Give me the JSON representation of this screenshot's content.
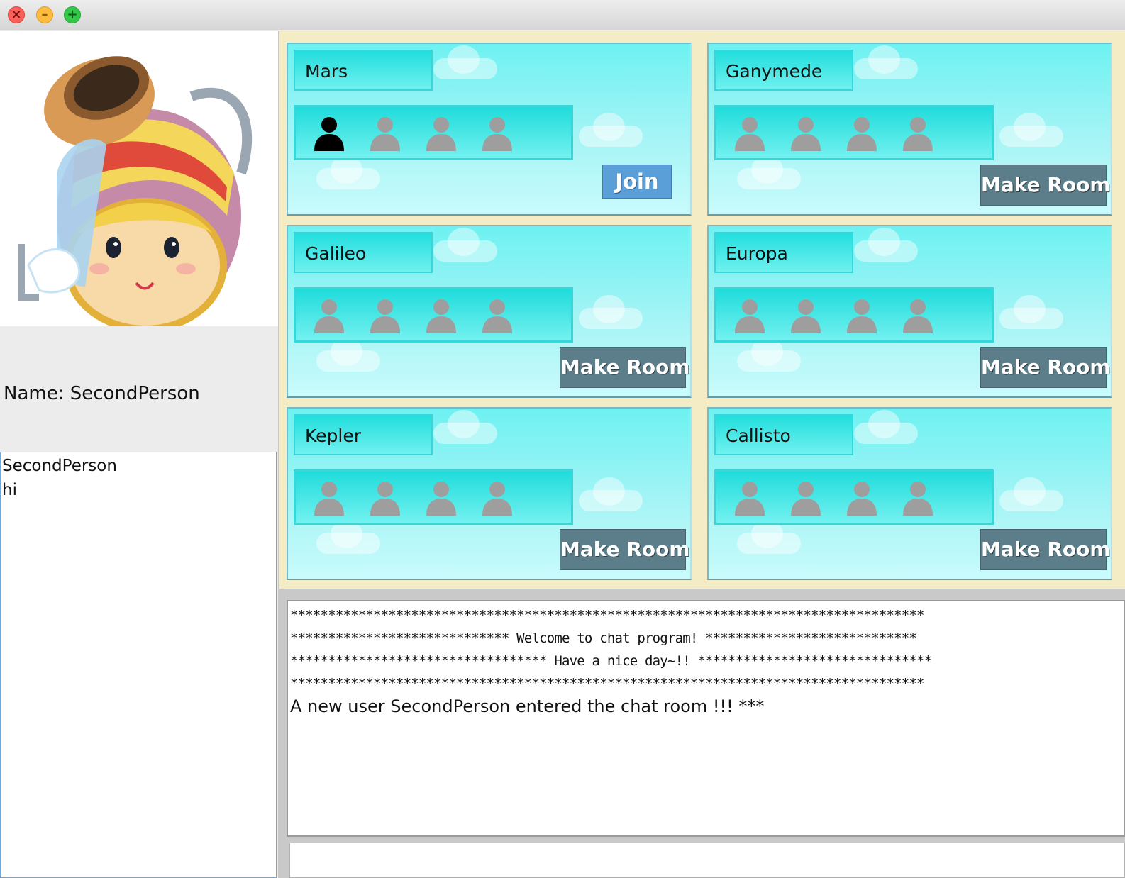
{
  "window": {
    "controls": [
      "close",
      "minimize",
      "maximize"
    ]
  },
  "profile": {
    "avatar_icon": "aquarius-character-icon",
    "name_label": "Name: SecondPerson"
  },
  "user_list": {
    "items": [
      "SecondPerson",
      "hi"
    ]
  },
  "rooms": [
    {
      "name": "Mars",
      "seats_occupied": 1,
      "seats_total": 4,
      "button_label": "Join",
      "button_type": "join"
    },
    {
      "name": "Ganymede",
      "seats_occupied": 0,
      "seats_total": 4,
      "button_label": "Make Room",
      "button_type": "make"
    },
    {
      "name": "Galileo",
      "seats_occupied": 0,
      "seats_total": 4,
      "button_label": "Make Room",
      "button_type": "make"
    },
    {
      "name": "Europa",
      "seats_occupied": 0,
      "seats_total": 4,
      "button_label": "Make Room",
      "button_type": "make"
    },
    {
      "name": "Kepler",
      "seats_occupied": 0,
      "seats_total": 4,
      "button_label": "Make Room",
      "button_type": "make"
    },
    {
      "name": "Callisto",
      "seats_occupied": 0,
      "seats_total": 4,
      "button_label": "Make Room",
      "button_type": "make"
    }
  ],
  "chat": {
    "lines": [
      "************************************************************************************",
      "***************************** Welcome to chat program! ****************************",
      "********************************** Have a nice day~!! *******************************",
      "************************************************************************************",
      "A new user SecondPerson entered the chat room !!! ***"
    ],
    "input_value": ""
  },
  "colors": {
    "card_top": "#6ef1f2",
    "card_bottom": "#c9fbfc",
    "rooms_background": "#f4ecc4",
    "join_button": "#5a9fd8",
    "make_button": "#5b7e8a",
    "seat_empty": "#9e9e9e",
    "seat_occupied": "#000000"
  }
}
